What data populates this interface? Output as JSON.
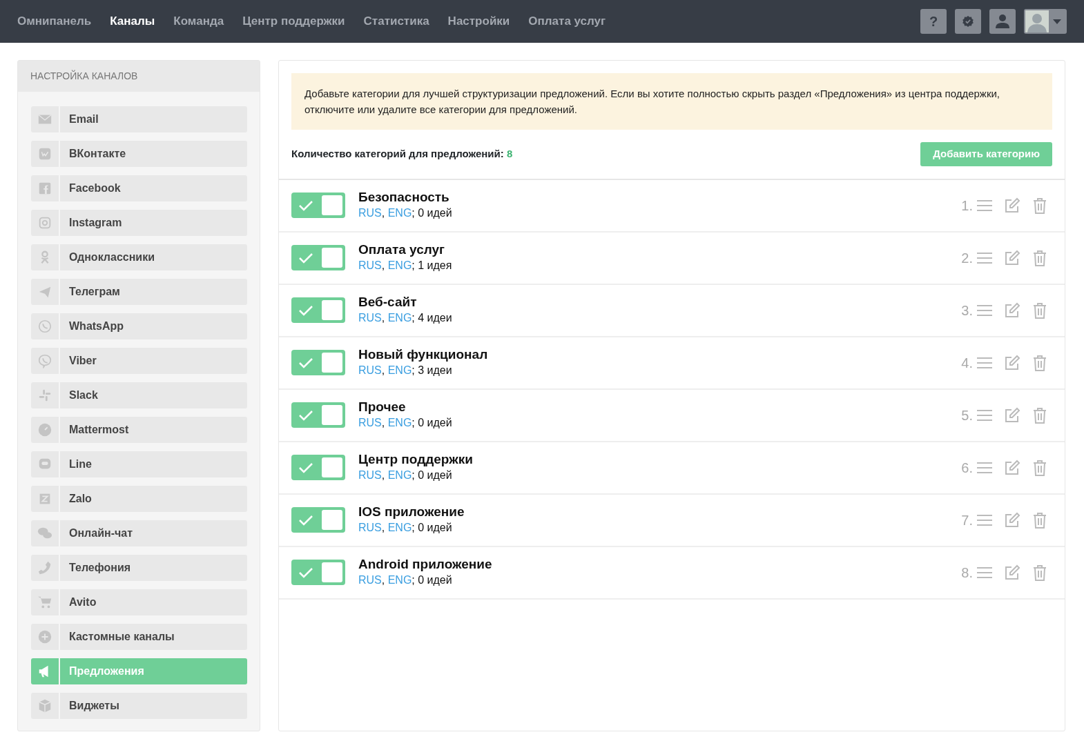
{
  "nav": {
    "items": [
      {
        "label": "Омнипанель",
        "selected": false
      },
      {
        "label": "Каналы",
        "selected": true
      },
      {
        "label": "Команда",
        "selected": false
      },
      {
        "label": "Центр поддержки",
        "selected": false
      },
      {
        "label": "Статистика",
        "selected": false
      },
      {
        "label": "Настройки",
        "selected": false
      },
      {
        "label": "Оплата услуг",
        "selected": false
      }
    ],
    "help_label": "?"
  },
  "sidebar": {
    "title": "НАСТРОЙКА КАНАЛОВ",
    "items": [
      {
        "label": "Email",
        "selected": false
      },
      {
        "label": "ВКонтакте",
        "selected": false
      },
      {
        "label": "Facebook",
        "selected": false
      },
      {
        "label": "Instagram",
        "selected": false
      },
      {
        "label": "Одноклассники",
        "selected": false
      },
      {
        "label": "Телеграм",
        "selected": false
      },
      {
        "label": "WhatsApp",
        "selected": false
      },
      {
        "label": "Viber",
        "selected": false
      },
      {
        "label": "Slack",
        "selected": false
      },
      {
        "label": "Mattermost",
        "selected": false
      },
      {
        "label": "Line",
        "selected": false
      },
      {
        "label": "Zalo",
        "selected": false
      },
      {
        "label": "Онлайн-чат",
        "selected": false
      },
      {
        "label": "Телефония",
        "selected": false
      },
      {
        "label": "Avito",
        "selected": false
      },
      {
        "label": "Кастомные каналы",
        "selected": false
      },
      {
        "label": "Предложения",
        "selected": true
      },
      {
        "label": "Виджеты",
        "selected": false
      }
    ]
  },
  "notice": "Добавьте категории для лучшей структуризации предложений. Если вы хотите полностью скрыть раздел «Предложения» из центра поддержки, отключите или удалите все категории для предложений.",
  "count_label": "Количество категорий для предложений:",
  "count": "8",
  "add_button": "Добавить категорию",
  "categories": [
    {
      "number": "1.",
      "name": "Безопасность",
      "on": true,
      "languages": [
        "RUS",
        "ENG"
      ],
      "language_separator": ", ",
      "ideas": "; 0 идей"
    },
    {
      "number": "2.",
      "name": "Оплата услуг",
      "on": true,
      "languages": [
        "RUS",
        "ENG"
      ],
      "language_separator": ", ",
      "ideas": "; 1 идея"
    },
    {
      "number": "3.",
      "name": "Веб-сайт",
      "on": true,
      "languages": [
        "RUS",
        "ENG"
      ],
      "language_separator": ", ",
      "ideas": "; 4 идеи"
    },
    {
      "number": "4.",
      "name": "Новый функционал",
      "on": true,
      "languages": [
        "RUS",
        "ENG"
      ],
      "language_separator": ", ",
      "ideas": "; 3 идеи"
    },
    {
      "number": "5.",
      "name": "Прочее",
      "on": true,
      "languages": [
        "RUS",
        "ENG"
      ],
      "language_separator": ", ",
      "ideas": "; 0 идей"
    },
    {
      "number": "6.",
      "name": "Центр поддержки",
      "on": true,
      "languages": [
        "RUS",
        "ENG"
      ],
      "language_separator": ", ",
      "ideas": "; 0 идей"
    },
    {
      "number": "7.",
      "name": "IOS приложение",
      "on": true,
      "languages": [
        "RUS",
        "ENG"
      ],
      "language_separator": ", ",
      "ideas": "; 0 идей"
    },
    {
      "number": "8.",
      "name": "Android приложение",
      "on": true,
      "languages": [
        "RUS",
        "ENG"
      ],
      "language_separator": ", ",
      "ideas": "; 0 идей"
    }
  ]
}
